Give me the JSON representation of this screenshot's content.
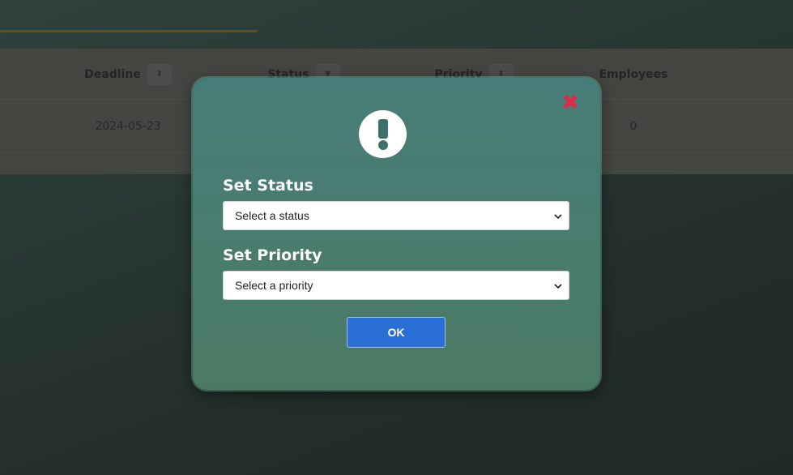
{
  "table": {
    "columns": [
      {
        "label": "Deadline",
        "control": "sort"
      },
      {
        "label": "Status",
        "control": "filter"
      },
      {
        "label": "Priority",
        "control": "sort"
      },
      {
        "label": "Employees",
        "control": "none"
      }
    ],
    "row": {
      "deadline": "2024-05-23",
      "employees": "0"
    }
  },
  "modal": {
    "close_icon": "✖",
    "alert_icon": "exclamation-icon",
    "status": {
      "label": "Set Status",
      "selected": "Select a status"
    },
    "priority": {
      "label": "Set Priority",
      "selected": "Select a priority"
    },
    "ok_label": "OK"
  },
  "colors": {
    "accent": "#2a6fd6",
    "close": "#e0284a",
    "modal": "#477d78",
    "icon": "#3f6f6a"
  }
}
